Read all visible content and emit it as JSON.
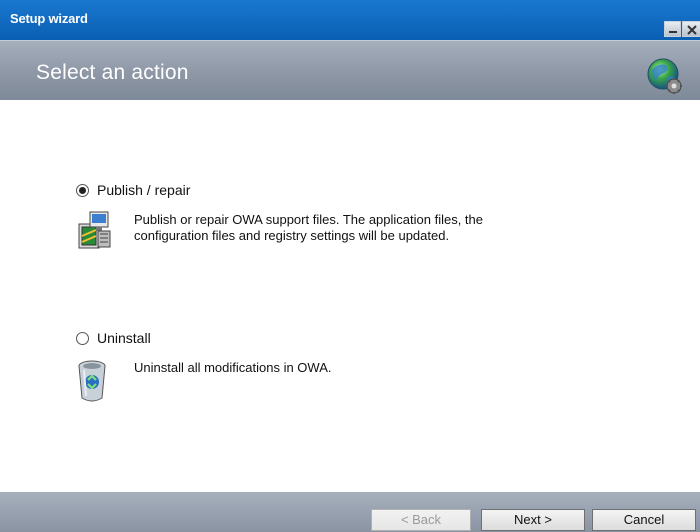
{
  "window": {
    "title": "Setup wizard"
  },
  "header": {
    "title": "Select an action",
    "icon": "globe-settings-icon"
  },
  "options": [
    {
      "label": "Publish / repair",
      "selected": true,
      "description_line1": "Publish or repair OWA support files. The application files, the",
      "description_line2": "configuration files and registry settings will be updated.",
      "icon": "install-package-icon"
    },
    {
      "label": "Uninstall",
      "selected": false,
      "description_line1": "Uninstall all modifications in OWA.",
      "icon": "recycle-bin-icon"
    }
  ],
  "buttons": {
    "back": "< Back",
    "next": "Next >",
    "cancel": "Cancel"
  },
  "colors": {
    "titlebar": "#0a64b8",
    "header": "#8d97a6"
  }
}
